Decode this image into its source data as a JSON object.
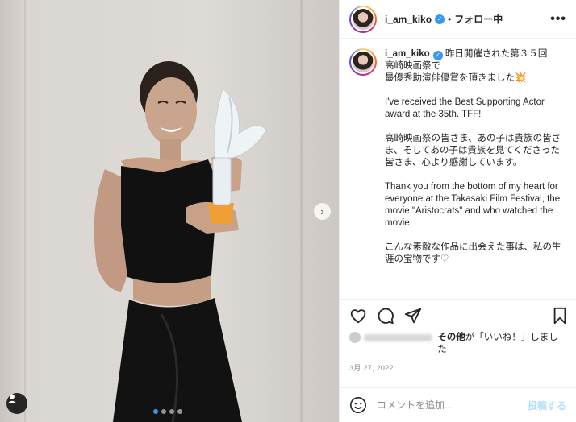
{
  "account": {
    "username": "i_am_kiko",
    "follow_state": "フォロー中",
    "separator": "•",
    "more": "•••"
  },
  "caption": {
    "username": "i_am_kiko",
    "paragraphs": [
      "昨日開催された第３５回\n高崎映画祭で\n最優秀助演俳優賞を頂きました💥",
      "I've received the Best Supporting Actor award at the 35th. TFF!",
      "高崎映画祭の皆さま、あの子は貴族の皆さま、そしてあの子は貴族を見てくださった皆さま、心より感謝しています。",
      "Thank you from the bottom of my heart for everyone at the Takasaki Film Festival, the movie \"Aristocrats\" and who watched the movie.",
      "こんな素敵な作品に出会えた事は、私の生涯の宝物です♡"
    ]
  },
  "likes": {
    "prefix": "その他",
    "text": "が「いいね！」しました"
  },
  "date": "3月 27, 2022",
  "comment": {
    "placeholder": "コメントを追加...",
    "post_label": "投稿する"
  },
  "carousel": {
    "total": 4,
    "active": 0
  },
  "icons": [
    "heart-icon",
    "comment-icon",
    "share-icon",
    "bookmark-icon",
    "emoji-icon",
    "user-tag-icon",
    "chevron-right-icon",
    "verified-icon",
    "more-icon"
  ],
  "colors": {
    "accent": "#3897f0",
    "post_disabled": "#b2dffc"
  }
}
